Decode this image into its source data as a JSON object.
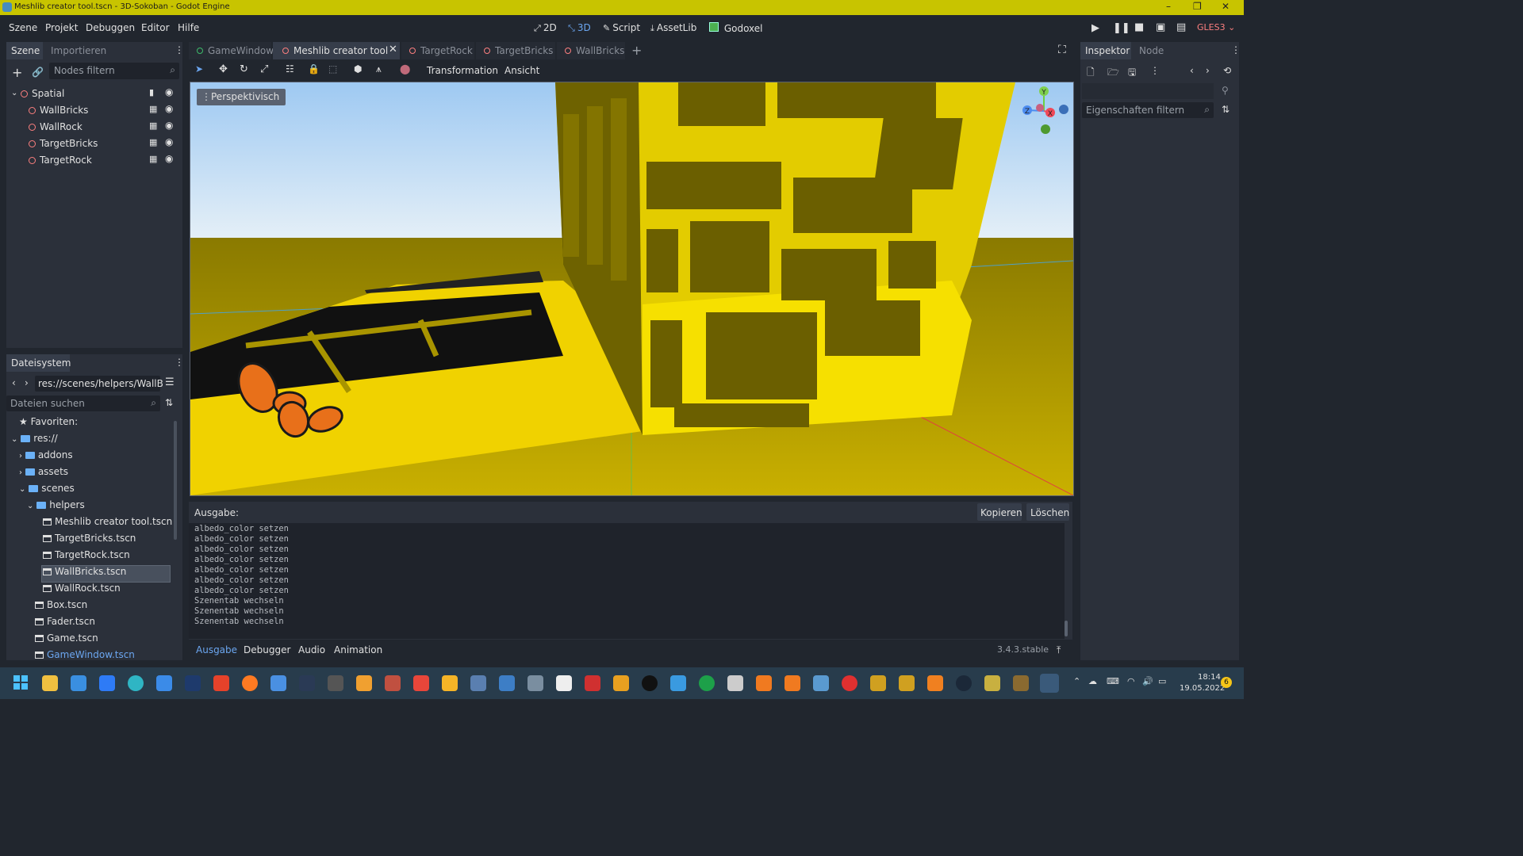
{
  "window": {
    "title": "Meshlib creator tool.tscn - 3D-Sokoban - Godot Engine",
    "controls": [
      "–",
      "❐",
      "✕"
    ]
  },
  "menu": [
    "Szene",
    "Projekt",
    "Debuggen",
    "Editor",
    "Hilfe"
  ],
  "modes": [
    {
      "label": "2D",
      "icon": "2d-icon"
    },
    {
      "label": "3D",
      "icon": "3d-icon",
      "active": true
    },
    {
      "label": "Script",
      "icon": "script-icon"
    },
    {
      "label": "AssetLib",
      "icon": "assetlib-icon"
    },
    {
      "label": "Godoxel",
      "icon": "godoxel-icon"
    }
  ],
  "renderer": "GLES3",
  "scene_dock": {
    "tabs": [
      "Szene",
      "Importieren"
    ],
    "filter_placeholder": "Nodes filtern",
    "tree": [
      {
        "name": "Spatial",
        "root": true
      },
      {
        "name": "WallBricks"
      },
      {
        "name": "WallRock"
      },
      {
        "name": "TargetBricks"
      },
      {
        "name": "TargetRock"
      }
    ]
  },
  "filesystem": {
    "title": "Dateisystem",
    "path": "res://scenes/helpers/WallB",
    "search_placeholder": "Dateien suchen",
    "items": [
      {
        "label": "Favoriten:",
        "type": "fav",
        "indent": 0
      },
      {
        "label": "res://",
        "type": "folder",
        "indent": 0,
        "open": true
      },
      {
        "label": "addons",
        "type": "folder",
        "indent": 1
      },
      {
        "label": "assets",
        "type": "folder",
        "indent": 1
      },
      {
        "label": "scenes",
        "type": "folder",
        "indent": 1,
        "open": true
      },
      {
        "label": "helpers",
        "type": "folder",
        "indent": 2,
        "open": true
      },
      {
        "label": "Meshlib creator tool.tscn",
        "type": "scene",
        "indent": 3
      },
      {
        "label": "TargetBricks.tscn",
        "type": "scene",
        "indent": 3
      },
      {
        "label": "TargetRock.tscn",
        "type": "scene",
        "indent": 3
      },
      {
        "label": "WallBricks.tscn",
        "type": "scene",
        "indent": 3,
        "selected": true
      },
      {
        "label": "WallRock.tscn",
        "type": "scene",
        "indent": 3
      },
      {
        "label": "Box.tscn",
        "type": "scene",
        "indent": 2
      },
      {
        "label": "Fader.tscn",
        "type": "scene",
        "indent": 2
      },
      {
        "label": "Game.tscn",
        "type": "scene",
        "indent": 2
      },
      {
        "label": "GameWindow.tscn",
        "type": "scene",
        "indent": 2,
        "link": true
      }
    ]
  },
  "scene_tabs": [
    {
      "label": "GameWindow",
      "dot": "#3dbb6b"
    },
    {
      "label": "Meshlib creator tool",
      "dot": "#fc7f7f",
      "active": true
    },
    {
      "label": "TargetRock",
      "dot": "#fc7f7f"
    },
    {
      "label": "TargetBricks",
      "dot": "#fc7f7f"
    },
    {
      "label": "WallBricks",
      "dot": "#fc7f7f"
    }
  ],
  "viewport": {
    "menus": [
      "Transformation",
      "Ansicht"
    ],
    "view_label": "Perspektivisch",
    "gizmo": {
      "y": "Y",
      "x": "X",
      "z": "Z"
    }
  },
  "output": {
    "title": "Ausgabe:",
    "copy_label": "Kopieren",
    "clear_label": "Löschen",
    "lines": [
      "albedo_color setzen",
      "albedo_color setzen",
      "albedo_color setzen",
      "albedo_color setzen",
      "albedo_color setzen",
      "albedo_color setzen",
      "albedo_color setzen",
      "Szenentab wechseln",
      "Szenentab wechseln",
      "Szenentab wechseln"
    ]
  },
  "bottom_tabs": [
    "Ausgabe",
    "Debugger",
    "Audio",
    "Animation"
  ],
  "version": "3.4.3.stable",
  "inspector": {
    "tabs": [
      "Inspektor",
      "Node"
    ],
    "filter_placeholder": "Eigenschaften filtern"
  },
  "taskbar": {
    "time": "18:14",
    "date": "19.05.2022",
    "notification_count": "6"
  },
  "colors": {
    "accent": "#6ba6f0",
    "node": "#fc7f7f",
    "titlebar": "#c8c400",
    "wall_yellow": "#e8d400",
    "sky": "#b8d8f4"
  }
}
